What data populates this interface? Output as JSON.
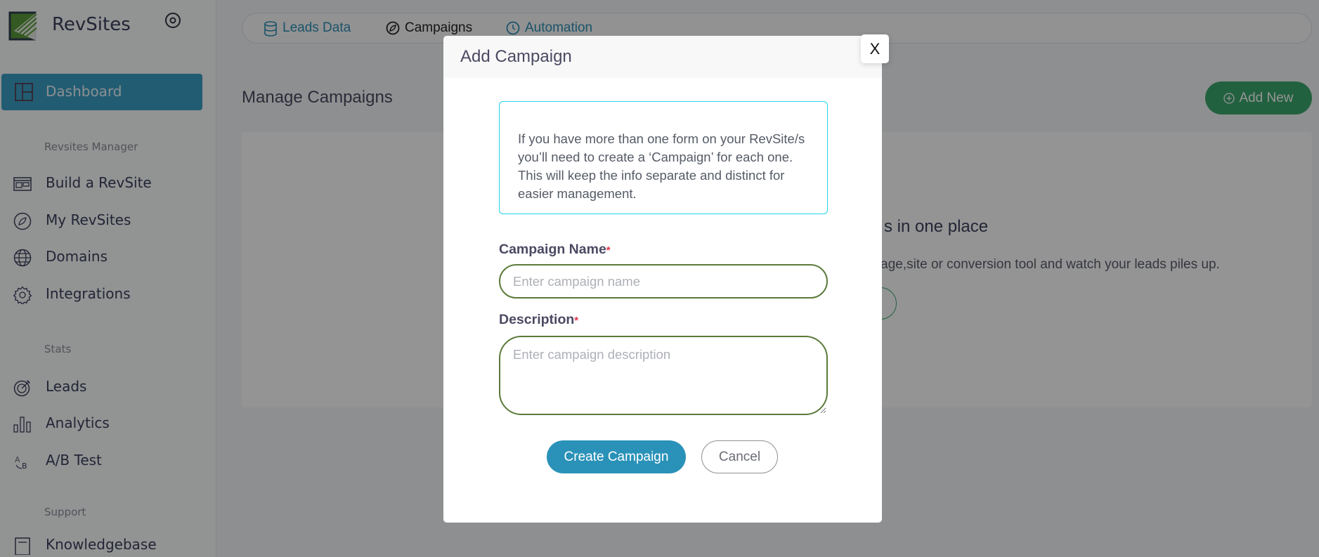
{
  "brand": {
    "name": "RevSites"
  },
  "sidebar": {
    "active": {
      "label": "Dashboard",
      "icon": "layout-icon"
    },
    "sections": [
      {
        "title": "Revsites Manager",
        "items": [
          {
            "label": "Build a RevSite",
            "icon": "browser-layout-icon"
          },
          {
            "label": "My RevSites",
            "icon": "compass-icon"
          },
          {
            "label": "Domains",
            "icon": "globe-icon"
          },
          {
            "label": "Integrations",
            "icon": "gear-icon"
          }
        ]
      },
      {
        "title": "Stats",
        "items": [
          {
            "label": "Leads",
            "icon": "target-icon"
          },
          {
            "label": "Analytics",
            "icon": "bar-chart-icon"
          },
          {
            "label": "A/B Test",
            "icon": "ab-test-icon"
          }
        ]
      },
      {
        "title": "Support",
        "items": [
          {
            "label": "Knowledgebase",
            "icon": "book-icon"
          }
        ]
      }
    ]
  },
  "tabs": [
    {
      "label": "Leads Data",
      "icon": "database-icon"
    },
    {
      "label": "Campaigns",
      "icon": "compass-icon",
      "active": true
    },
    {
      "label": "Automation",
      "icon": "clock-icon"
    }
  ],
  "main": {
    "title": "Manage Campaigns",
    "add_new_label": "Add New",
    "empty_heading_visible": "s in one place",
    "empty_text_visible": "; page,site or conversion tool and watch your leads piles up."
  },
  "modal": {
    "title": "Add Campaign",
    "close_label": "X",
    "info": "If you have more than one form on your RevSite/s you’ll need to create a ‘Campaign’ for each one. This will keep the info separate and distinct for easier management.",
    "name_label": "Campaign Name",
    "name_placeholder": "Enter campaign name",
    "description_label": "Description",
    "description_placeholder": "Enter campaign description",
    "required_mark": "*",
    "create_label": "Create Campaign",
    "cancel_label": "Cancel"
  },
  "colors": {
    "accent": "#2a92b8",
    "success": "#3aa76d",
    "info_border": "#22d3e6",
    "input_border": "#5a7a3a",
    "required": "#e0334a"
  }
}
